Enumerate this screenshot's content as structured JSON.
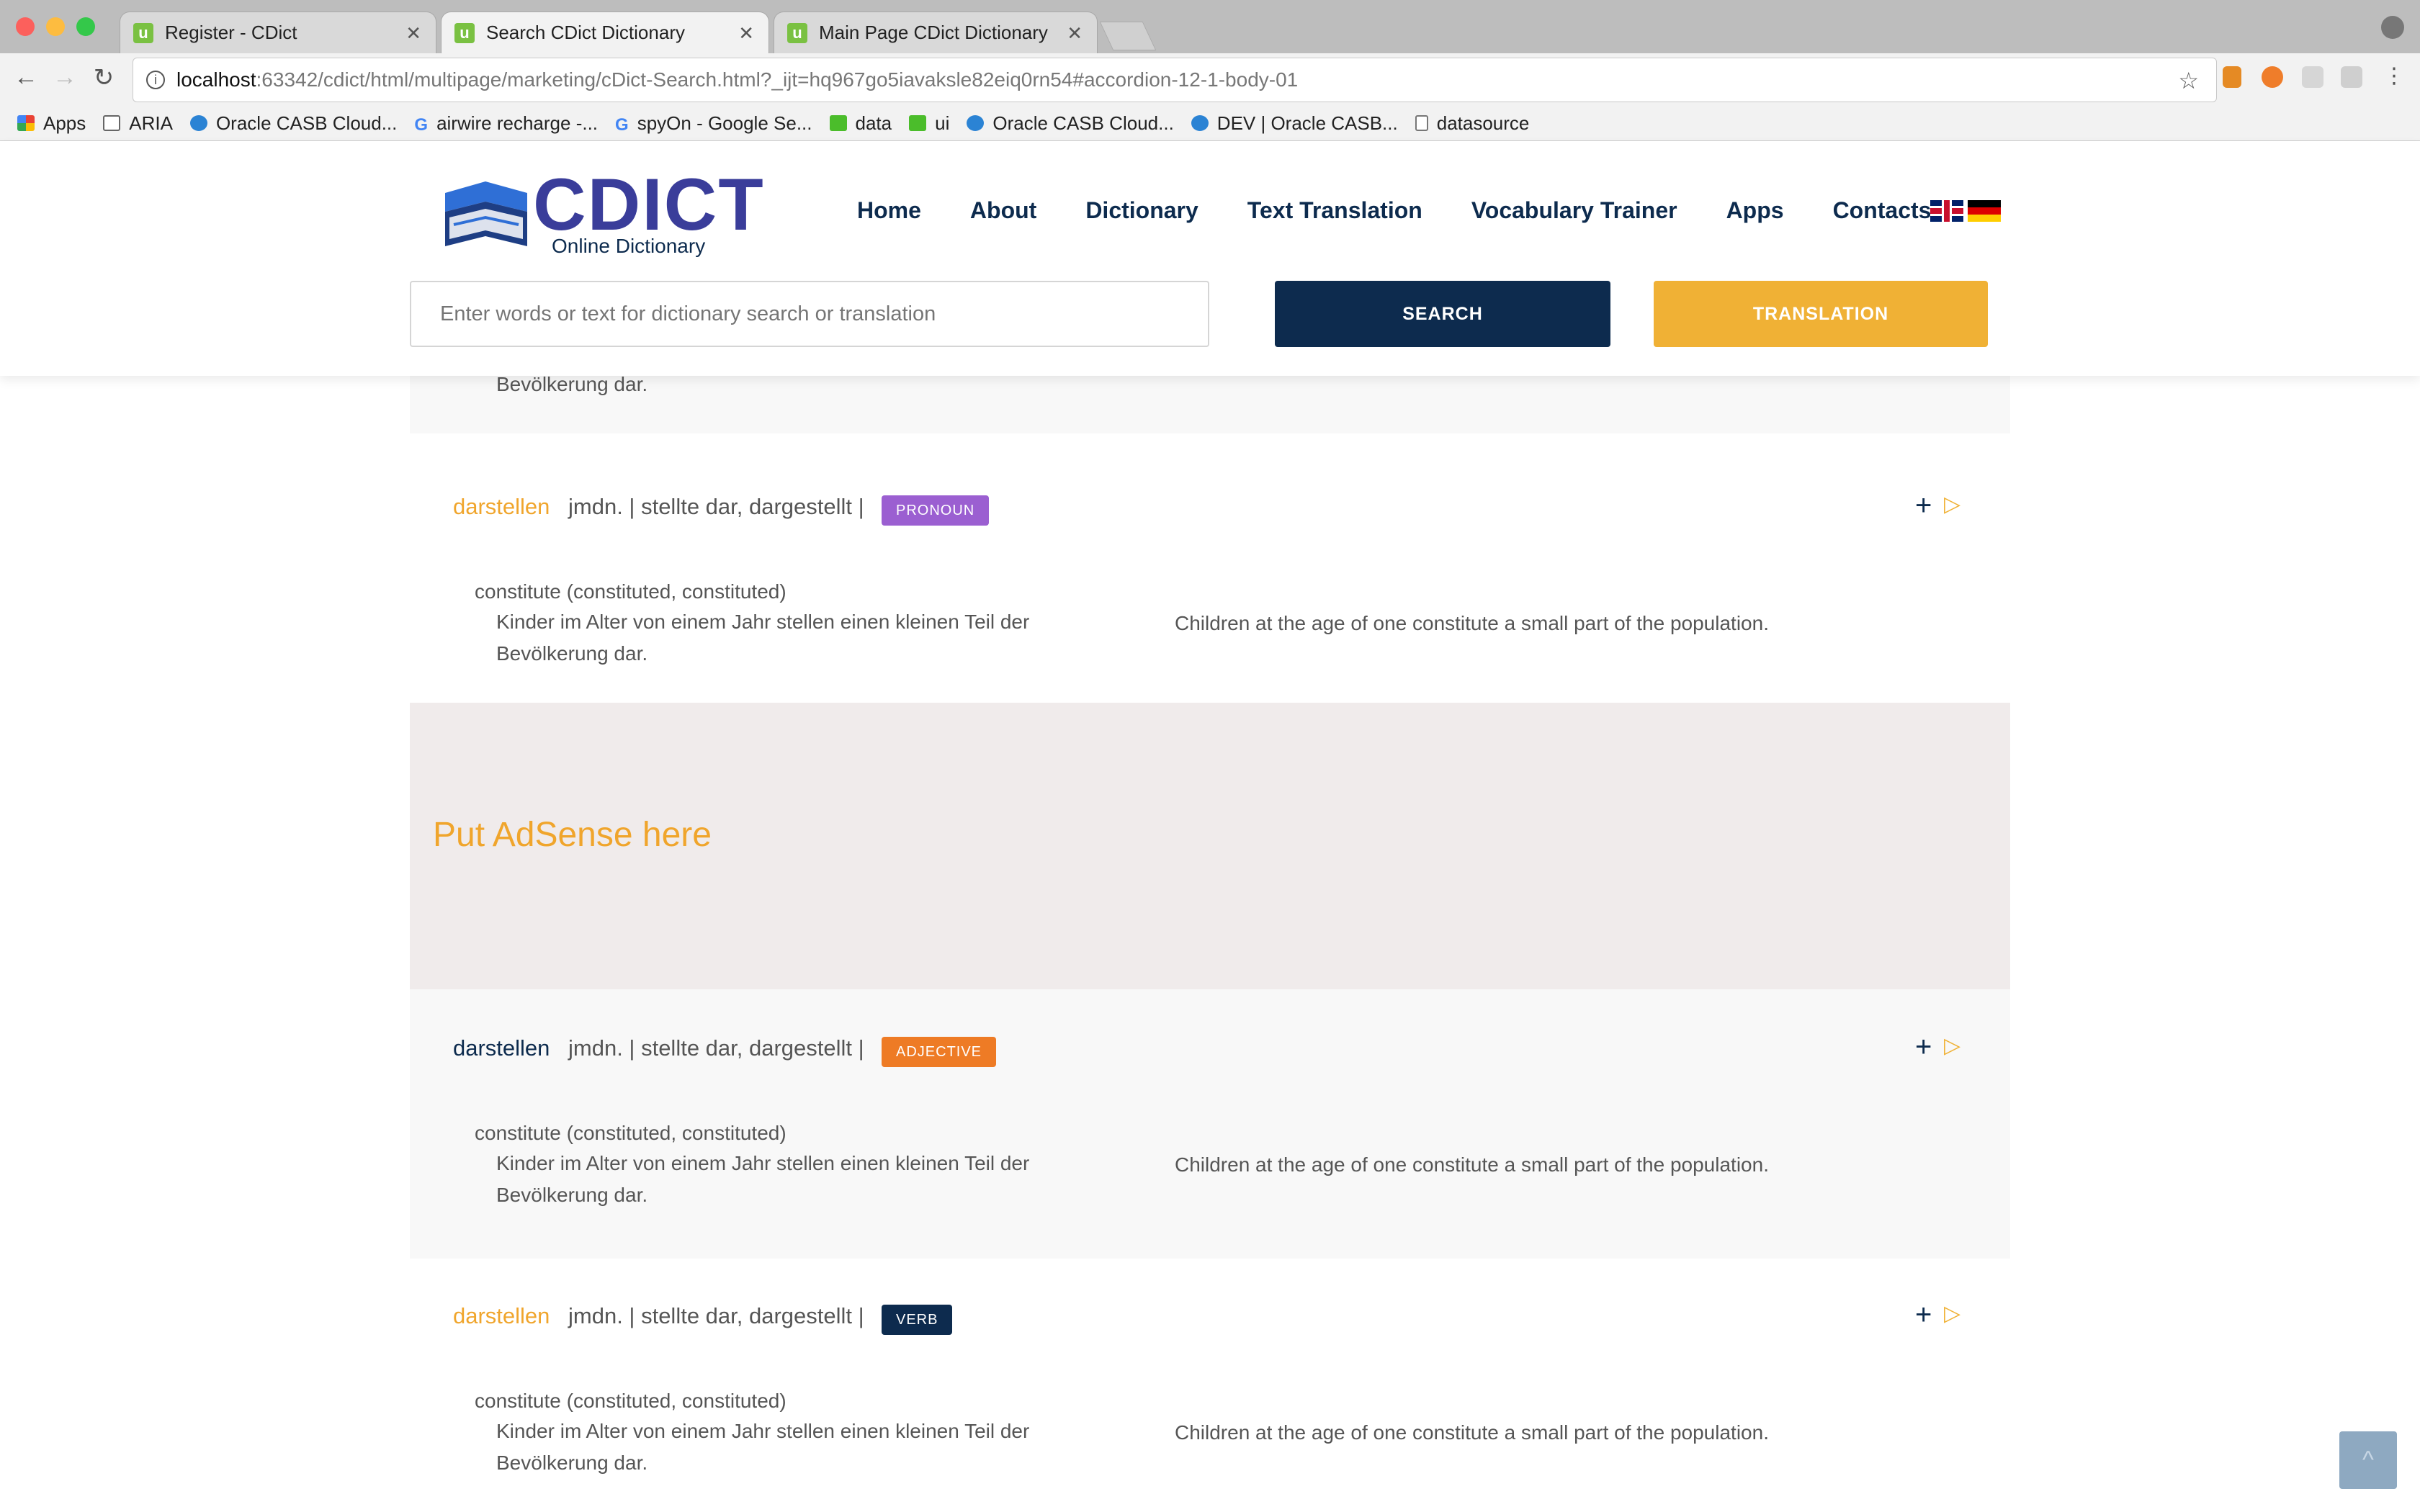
{
  "browser": {
    "tabs": [
      {
        "title": "Register - CDict"
      },
      {
        "title": "Search CDict Dictionary"
      },
      {
        "title": "Main Page CDict Dictionary"
      }
    ],
    "url_host": "localhost",
    "url_path": ":63342/cdict/html/multipage/marketing/cDict-Search.html?_ijt=hq967go5iavaksle82eiq0rn54#accordion-12-1-body-01",
    "bookmarks": [
      {
        "label": "Apps",
        "icon": "apps-grid-icon"
      },
      {
        "label": "ARIA",
        "icon": "folder-icon"
      },
      {
        "label": "Oracle CASB Cloud...",
        "icon": "cloud-icon"
      },
      {
        "label": "airwire recharge -...",
        "icon": "google-icon"
      },
      {
        "label": "spyOn - Google Se...",
        "icon": "google-icon"
      },
      {
        "label": "data",
        "icon": "green-stairs-icon"
      },
      {
        "label": "ui",
        "icon": "green-stairs-icon"
      },
      {
        "label": "Oracle CASB Cloud...",
        "icon": "cloud-icon"
      },
      {
        "label": "DEV | Oracle CASB...",
        "icon": "cloud-icon"
      },
      {
        "label": "datasource",
        "icon": "page-icon"
      }
    ]
  },
  "site": {
    "logo_word": "CDICT",
    "logo_sub": "Online Dictionary",
    "nav": [
      "Home",
      "About",
      "Dictionary",
      "Text Translation",
      "Vocabulary Trainer",
      "Apps",
      "Contacts"
    ],
    "search_placeholder": "Enter words or text for dictionary search or translation",
    "search_button": "SEARCH",
    "translation_button": "TRANSLATION"
  },
  "partial_entry_text": "Bevölkerung dar.",
  "entries": [
    {
      "word": "darstellen",
      "forms": "jmdn. | stellte dar, dargestellt |",
      "pos": "PRONOUN",
      "sense": "constitute (constituted, constituted)",
      "example_de": "Kinder im Alter von einem Jahr stellen einen kleinen Teil der Bevölkerung dar.",
      "example_en": "Children at the age of one constitute a small part of the population."
    },
    {
      "word": "darstellen",
      "forms": "jmdn. | stellte dar, dargestellt |",
      "pos": "ADJECTIVE",
      "sense": "constitute (constituted, constituted)",
      "example_de": "Kinder im Alter von einem Jahr stellen einen kleinen Teil der Bevölkerung dar.",
      "example_en": "Children at the age of one constitute a small part of the population."
    },
    {
      "word": "darstellen",
      "forms": "jmdn. | stellte dar, dargestellt |",
      "pos": "VERB",
      "sense": "constitute (constituted, constituted)",
      "example_de": "Kinder im Alter von einem Jahr stellen einen kleinen Teil der Bevölkerung dar.",
      "example_en": "Children at the age of one constitute a small part of the population."
    }
  ],
  "ad_text": "Put AdSense here",
  "colors": {
    "navy": "#0d2b4e",
    "orange": "#f0b135",
    "pronoun": "#9b5fd1",
    "adjective": "#ee7b25"
  }
}
